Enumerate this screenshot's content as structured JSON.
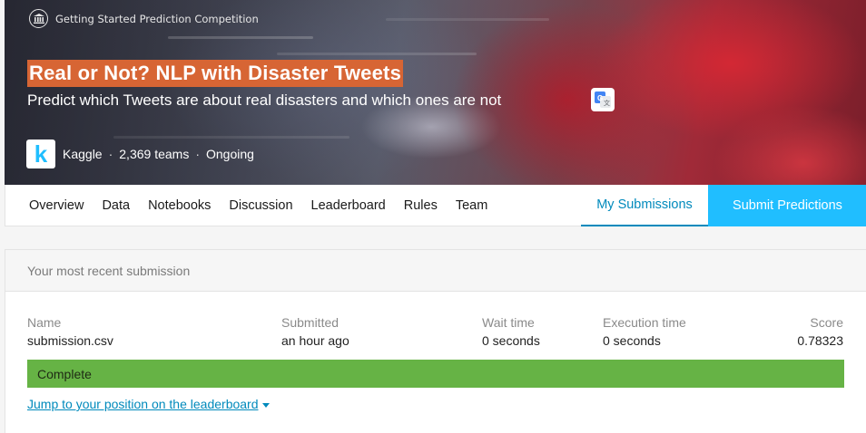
{
  "banner": {
    "competition_type": "Getting Started Prediction Competition",
    "competition_type_icon": "bank-icon",
    "title": "Real or Not? NLP with Disaster Tweets",
    "subtitle": "Predict which Tweets are about real disasters and which ones are not",
    "translate_icon": "google-translate-icon",
    "host_logo_letter": "k",
    "host": "Kaggle",
    "separator": "·",
    "teams": "2,369 teams",
    "status": "Ongoing",
    "title_highlight_color": "#d76534"
  },
  "tabs": {
    "items": [
      "Overview",
      "Data",
      "Notebooks",
      "Discussion",
      "Leaderboard",
      "Rules",
      "Team"
    ],
    "active": "My Submissions",
    "submit_label": "Submit Predictions",
    "accent_color": "#20beff"
  },
  "submission": {
    "header": "Your most recent submission",
    "columns": {
      "name_label": "Name",
      "name_value": "submission.csv",
      "submitted_label": "Submitted",
      "submitted_value": "an hour ago",
      "wait_label": "Wait time",
      "wait_value": "0 seconds",
      "exec_label": "Execution time",
      "exec_value": "0 seconds",
      "score_label": "Score",
      "score_value": "0.78323"
    },
    "status": "Complete",
    "status_color": "#66b345",
    "jump_link": "Jump to your position on the leaderboard"
  }
}
